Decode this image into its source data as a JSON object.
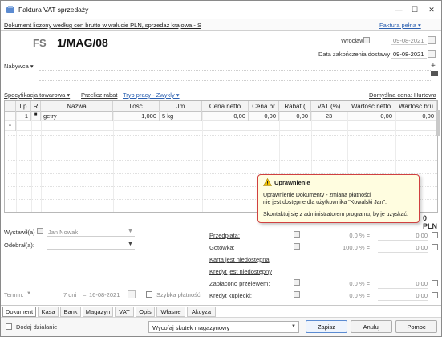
{
  "window": {
    "title": "Faktura VAT sprzedaży",
    "minimize": "—",
    "maximize": "☐",
    "close": "✕"
  },
  "info": {
    "description": "Dokument liczony według cen brutto w walucie PLN, sprzedaż krajowa - S",
    "full_link": "Faktura pełna ▾"
  },
  "document": {
    "type": "FS",
    "number": "1/MAG/08",
    "place_label": "Wrocław",
    "issue_date": "09-08-2021",
    "delivery_label": "Data zakończenia dostawy",
    "delivery_date": "09-08-2021"
  },
  "buyer": {
    "label": "Nabywca ▾"
  },
  "spec": {
    "label": "Specyfikacja towarowa ▾",
    "recalc": "Przelicz rabat",
    "mode": "Tryb pracy - Zwykły ▾",
    "default_price": "Domyślna cena: Hurtowa"
  },
  "table": {
    "headers": [
      "Lp",
      "R",
      "Nazwa",
      "Ilość",
      "Jm",
      "Cena netto",
      "Cena br",
      "Rabat (",
      "VAT (%)",
      "Wartość netto",
      "Wartość bru"
    ],
    "rows": [
      {
        "lp": "1",
        "r": "■",
        "name": "getry",
        "qty": "1,000",
        "unit": "5 kg",
        "net_price": "0,00",
        "gross_price": "0,00",
        "discount": "0,00",
        "vat": "23",
        "net_value": "0,00",
        "gross_value": "0,00"
      }
    ],
    "new_row_marker": "*"
  },
  "popup": {
    "title": "Uprawnienie",
    "line1": "Uprawnienie Dokumenty - zmiana płatności",
    "line2": "nie jest dostępne dla użytkownika \"Kowalski Jan\".",
    "line3": "Skontaktuj się z administratorem programu, by je uzyskać."
  },
  "summary": {
    "total": "0 PLN"
  },
  "parties": {
    "issued_label": "Wystawił(a)",
    "issued_value": "Jan Nowak",
    "received_label": "Odebrał(a):",
    "received_value": ""
  },
  "payments": {
    "prepay": {
      "label": "Przedpłata:",
      "pct": "0,0 % =",
      "amount": "0,00"
    },
    "cash": {
      "label": "Gotówka:",
      "pct": "100,0 % =",
      "amount": "0,00"
    },
    "card": "Karta jest niedostępna",
    "credit": "Kredyt jest niedostępny",
    "transfer": {
      "label": "Zapłacono przelewem:",
      "pct": "0,0 % =",
      "amount": "0,00"
    },
    "buyer_credit": {
      "label": "Kredyt kupiecki:",
      "pct": "0,0 % =",
      "amount": "0,00"
    }
  },
  "term": {
    "label": "Termin:",
    "days": "7 dni",
    "date": "16-08-2021",
    "quick_payment": "Szybka płatność"
  },
  "tabs": [
    "Dokument",
    "Kasa",
    "Bank",
    "Magazyn",
    "VAT",
    "Opis",
    "Własne",
    "Akcyza"
  ],
  "footer": {
    "add_action": "Dodaj działanie",
    "select_value": "Wycofaj skutek magazynowy",
    "save": "Zapisz",
    "cancel": "Anuluj",
    "help": "Pomoc"
  },
  "colors": {
    "link": "#2a5fb0",
    "popup_border": "#d04040",
    "popup_bg": "#fffde0"
  }
}
